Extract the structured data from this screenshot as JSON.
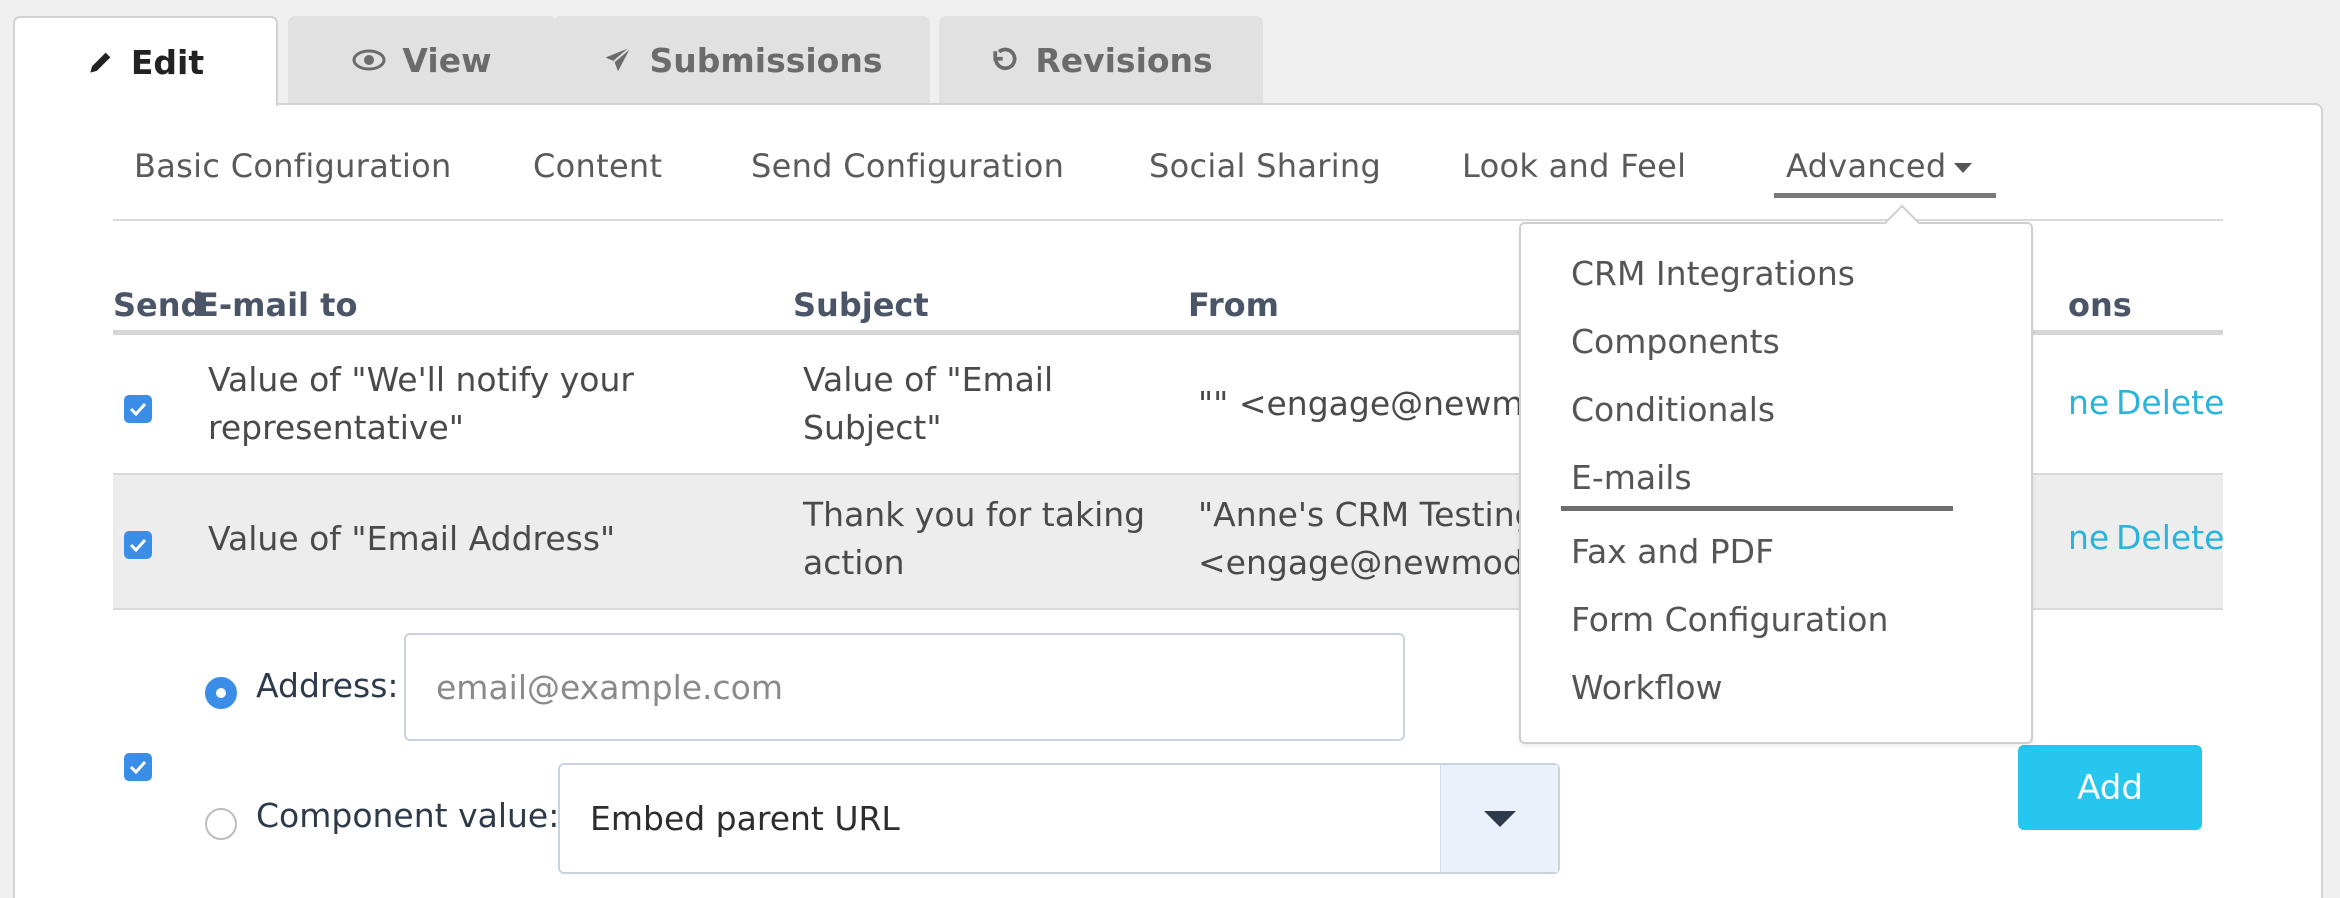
{
  "tabs": [
    {
      "label": "Edit",
      "icon": "pencil-icon",
      "active": true
    },
    {
      "label": "View",
      "icon": "eye-icon",
      "active": false
    },
    {
      "label": "Submissions",
      "icon": "paper-plane-icon",
      "active": false
    },
    {
      "label": "Revisions",
      "icon": "undo-icon",
      "active": false
    }
  ],
  "subnav": {
    "items": [
      "Basic Configuration",
      "Content",
      "Send Configuration",
      "Social Sharing",
      "Look and Feel"
    ],
    "advanced": "Advanced"
  },
  "table": {
    "headers": {
      "send": "Send",
      "email_to": "E-mail to",
      "subject": "Subject",
      "from": "From",
      "actions_partial": "ons"
    },
    "rows": [
      {
        "checked": true,
        "to_line1": "Value of \"We'll notify your",
        "to_line2": "representative\"",
        "subject_line1": "Value of \"Email",
        "subject_line2": "Subject\"",
        "from_line1": "\"\" <engage@newmo",
        "from_line2": "",
        "action_partial": "ne",
        "delete": "Delete"
      },
      {
        "checked": true,
        "to_line1": "Value of \"Email Address\"",
        "to_line2": "",
        "subject_line1": "Thank you for taking",
        "subject_line2": "action",
        "from_line1": "\"Anne's CRM Testing",
        "from_line2": "<engage@newmode",
        "action_partial": "ne",
        "delete": "Delete"
      }
    ]
  },
  "add_form": {
    "checked": true,
    "address_label": "Address:",
    "address_placeholder": "email@example.com",
    "component_label": "Component value:",
    "component_selected": "Embed parent URL",
    "add_button": "Add"
  },
  "advanced_menu": {
    "items": [
      "CRM Integrations",
      "Components",
      "Conditionals",
      "E-mails",
      "Fax and PDF",
      "Form Configuration",
      "Workflow"
    ],
    "selected": "E-mails"
  },
  "colors": {
    "accent": "#27c6ee",
    "link": "#2ab4dc",
    "checkbox": "#3b8ee8"
  }
}
